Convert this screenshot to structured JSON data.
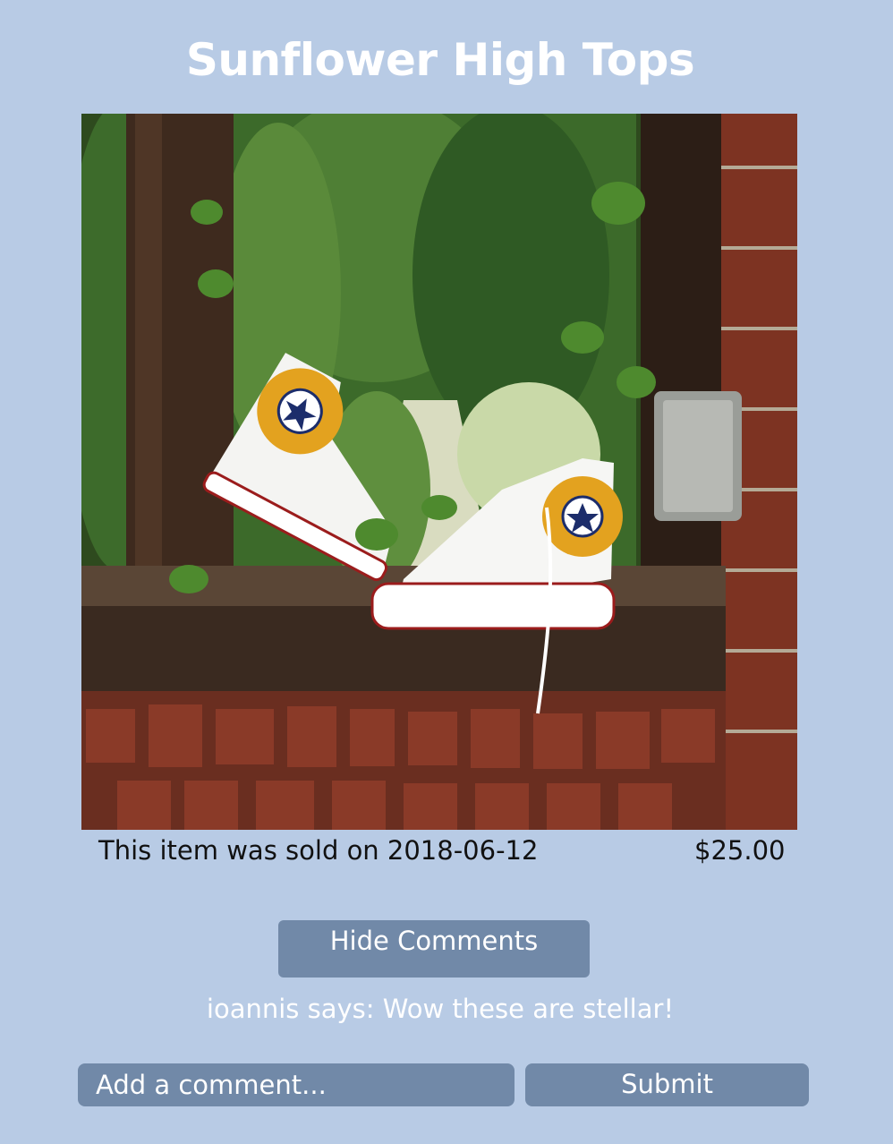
{
  "product": {
    "title": "Sunflower High Tops",
    "sold_text": "This item was sold on 2018-06-12",
    "price": "$25.00"
  },
  "comments": {
    "toggle_label": "Hide Comments",
    "items": [
      {
        "text": "ioannis says: Wow these are stellar!"
      }
    ],
    "input_placeholder": "Add a comment...",
    "submit_label": "Submit"
  },
  "colors": {
    "background": "#b8cbe5",
    "button": "#7189a8",
    "text_light": "#ffffff",
    "text_dark": "#111111"
  }
}
